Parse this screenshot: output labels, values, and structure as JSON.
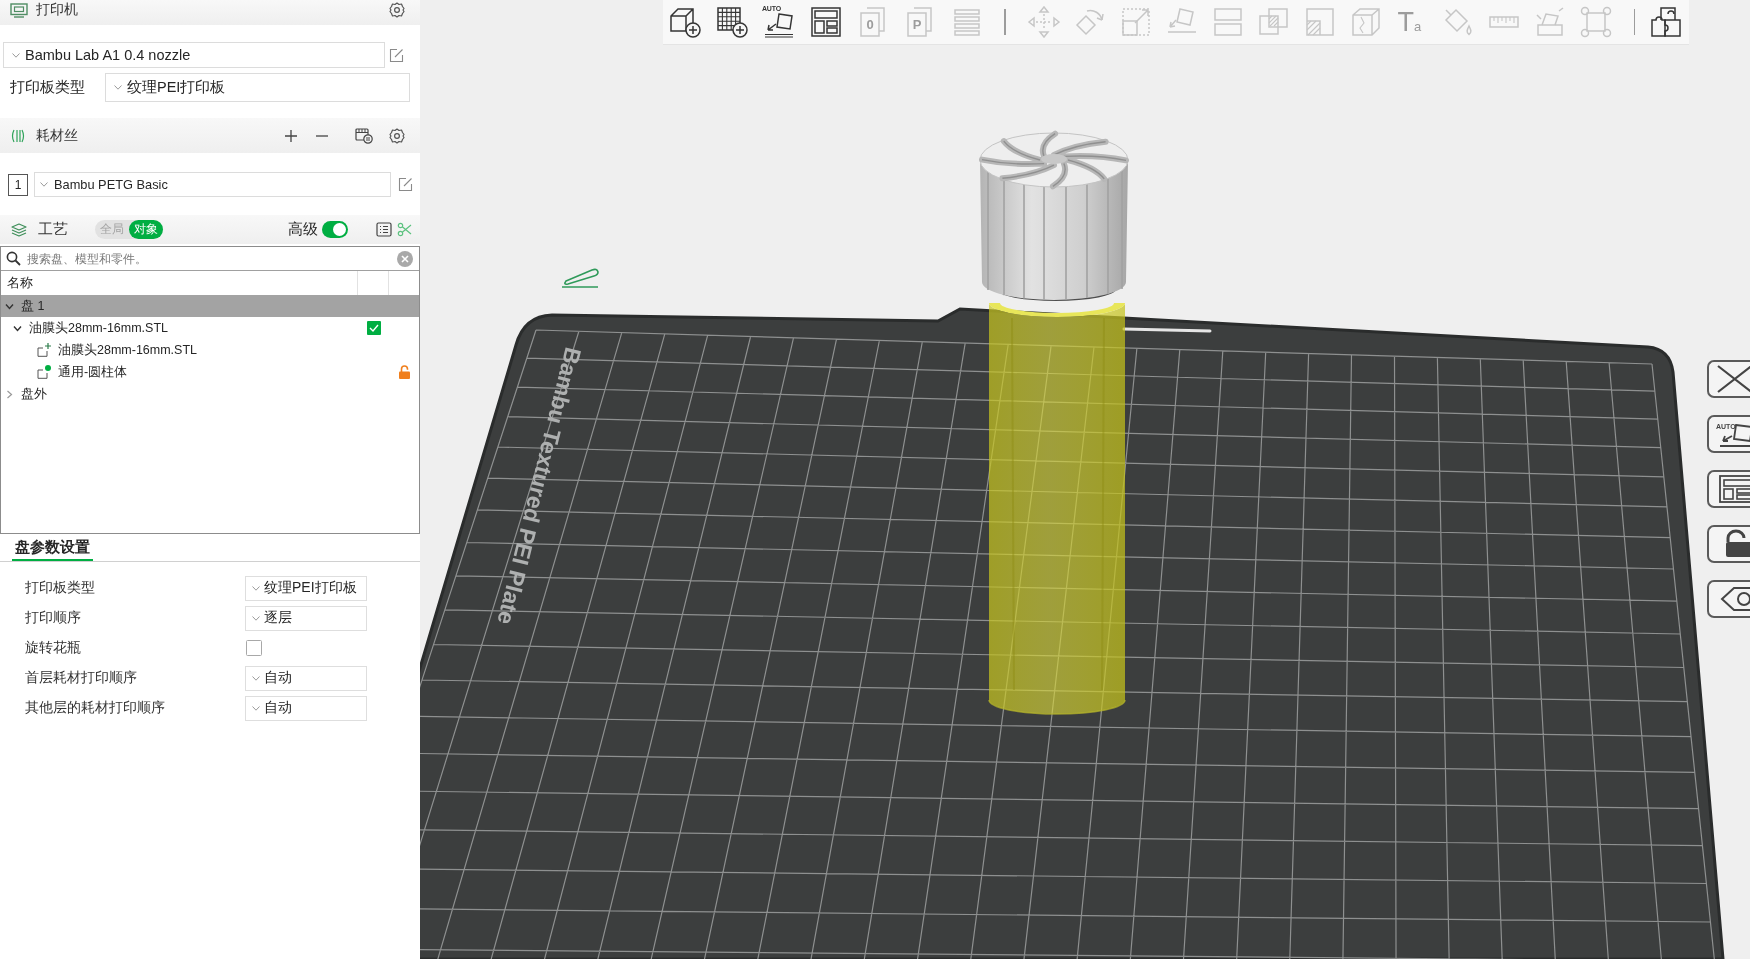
{
  "printer": {
    "title": "打印机",
    "preset": "Bambu Lab A1 0.4 nozzle",
    "plate_type_label": "打印板类型",
    "plate_type": "纹理PEI打印板"
  },
  "filament": {
    "title": "耗材丝",
    "slots": [
      {
        "number": "1",
        "preset": "Bambu PETG Basic"
      }
    ]
  },
  "process": {
    "title": "工艺",
    "scope": [
      {
        "label": "全局",
        "selected": false
      },
      {
        "label": "对象",
        "selected": true
      }
    ],
    "advanced": {
      "label": "高级",
      "on": true
    }
  },
  "object_list": {
    "search": {
      "placeholder": "搜索盘、模型和零件。"
    },
    "columns": [
      "名称"
    ],
    "items": [
      {
        "name": "盘 1",
        "selected": true,
        "expanded": true,
        "children": [
          {
            "name": "油膜头28mm-16mm.STL",
            "selected": false,
            "expanded": true,
            "checked": true,
            "children": [
              {
                "kind": "part",
                "name": "油膜头28mm-16mm.STL",
                "selected": false
              },
              {
                "kind": "modifier",
                "name": "通用-圆柱体",
                "selected": false,
                "locked": false
              }
            ]
          }
        ]
      },
      {
        "name": "盘外",
        "selected": false,
        "expanded": false
      }
    ]
  },
  "plate_settings": {
    "tabs": [
      {
        "label": "盘参数设置",
        "selected": true
      }
    ],
    "rows": [
      {
        "kind": "dropdown",
        "label": "打印板类型",
        "value": "纹理PEI打印板"
      },
      {
        "kind": "dropdown",
        "label": "打印顺序",
        "value": "逐层"
      },
      {
        "kind": "checkbox",
        "label": "旋转花瓶",
        "checked": false
      },
      {
        "kind": "dropdown",
        "label": "首层耗材打印顺序",
        "value": "自动"
      },
      {
        "kind": "dropdown",
        "label": "其他层的耗材打印顺序",
        "value": "自动"
      }
    ]
  },
  "toolbar": {
    "groups": [
      [
        {
          "disabled": false
        },
        {
          "disabled": false
        },
        {
          "disabled": false,
          "label": "AUTO"
        },
        {
          "disabled": false
        },
        {
          "disabled": true,
          "label": "0"
        },
        {
          "disabled": true,
          "label": "P"
        },
        {
          "disabled": true
        }
      ],
      [
        {
          "disabled": true
        },
        {
          "disabled": true
        },
        {
          "disabled": true
        },
        {
          "disabled": true
        },
        {
          "disabled": true
        },
        {
          "disabled": true
        },
        {
          "disabled": true
        },
        {
          "disabled": true
        },
        {
          "disabled": true,
          "label": "T$_{a}$"
        },
        {
          "disabled": true
        },
        {
          "disabled": true
        },
        {
          "disabled": true
        },
        {
          "disabled": true
        }
      ],
      [
        {
          "disabled": false
        }
      ]
    ]
  },
  "viewport": {
    "plate_label": "Bambu Textured PEI Plate"
  },
  "side_toolbar": {
    "auto_label": "AUTO"
  }
}
